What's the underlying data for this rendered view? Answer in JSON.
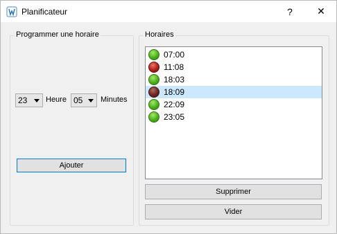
{
  "window": {
    "title": "Planificateur",
    "help_label": "?",
    "close_label": "✕"
  },
  "left": {
    "group_title": "Programmer une horaire",
    "hour_value": "23",
    "hour_label": "Heure",
    "minute_value": "05",
    "minute_label": "Minutes",
    "add_button": "Ajouter"
  },
  "right": {
    "group_title": "Horaires",
    "items": [
      {
        "time": "07:00",
        "status": "green",
        "selected": false
      },
      {
        "time": "11:08",
        "status": "red",
        "selected": false
      },
      {
        "time": "18:03",
        "status": "green",
        "selected": false
      },
      {
        "time": "18:09",
        "status": "red",
        "selected": true
      },
      {
        "time": "22:09",
        "status": "green",
        "selected": false
      },
      {
        "time": "23:05",
        "status": "green",
        "selected": false
      }
    ],
    "delete_button": "Supprimer",
    "clear_button": "Vider"
  },
  "colors": {
    "green": "#4caf1d",
    "red": "#b0201a",
    "selected_bg": "#cce8ff",
    "focus_border": "#0078d7"
  },
  "icons": {
    "app": "app-icon",
    "status": "status-light-icon"
  }
}
